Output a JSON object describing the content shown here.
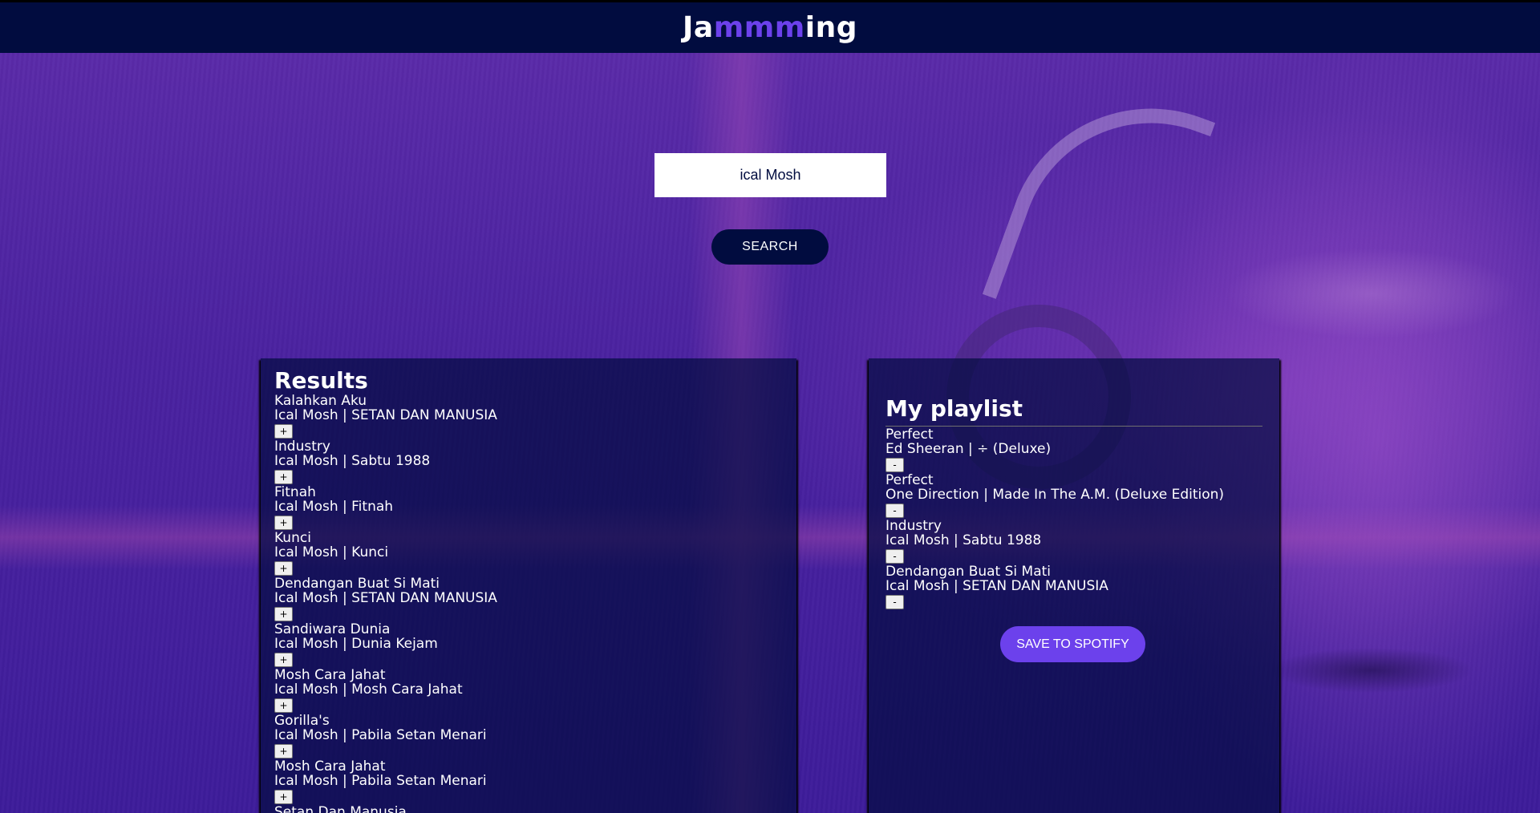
{
  "header": {
    "logo_prefix": "Ja",
    "logo_accent": "mmm",
    "logo_suffix": "ing"
  },
  "search": {
    "value": "ical Mosh",
    "button_label": "SEARCH"
  },
  "results": {
    "title": "Results",
    "add_label": "+",
    "tracks": [
      {
        "name": "Kalahkan Aku",
        "info": "Ical Mosh | SETAN DAN MANUSIA"
      },
      {
        "name": "Industry",
        "info": "Ical Mosh | Sabtu 1988"
      },
      {
        "name": "Fitnah",
        "info": "Ical Mosh | Fitnah"
      },
      {
        "name": "Kunci",
        "info": "Ical Mosh | Kunci"
      },
      {
        "name": "Dendangan Buat Si Mati",
        "info": "Ical Mosh | SETAN DAN MANUSIA"
      },
      {
        "name": "Sandiwara Dunia",
        "info": "Ical Mosh | Dunia Kejam"
      },
      {
        "name": "Mosh Cara Jahat",
        "info": "Ical Mosh | Mosh Cara Jahat"
      },
      {
        "name": "Gorilla's",
        "info": "Ical Mosh | Pabila Setan Menari"
      },
      {
        "name": "Mosh Cara Jahat",
        "info": "Ical Mosh | Pabila Setan Menari"
      },
      {
        "name": "Setan Dan Manusia",
        "info": ""
      }
    ]
  },
  "playlist": {
    "title": "My playlist",
    "remove_label": "-",
    "save_label": "SAVE TO SPOTIFY",
    "tracks": [
      {
        "name": "Perfect",
        "info": "Ed Sheeran | ÷ (Deluxe)"
      },
      {
        "name": "Perfect",
        "info": "One Direction | Made In The A.M. (Deluxe Edition)"
      },
      {
        "name": "Industry",
        "info": "Ical Mosh | Sabtu 1988"
      },
      {
        "name": "Dendangan Buat Si Mati",
        "info": "Ical Mosh | SETAN DAN MANUSIA"
      }
    ]
  },
  "colors": {
    "header_bg": "#010c3f",
    "accent": "#6c41ec",
    "panel_bg": "rgba(1,12,63,0.7)"
  }
}
